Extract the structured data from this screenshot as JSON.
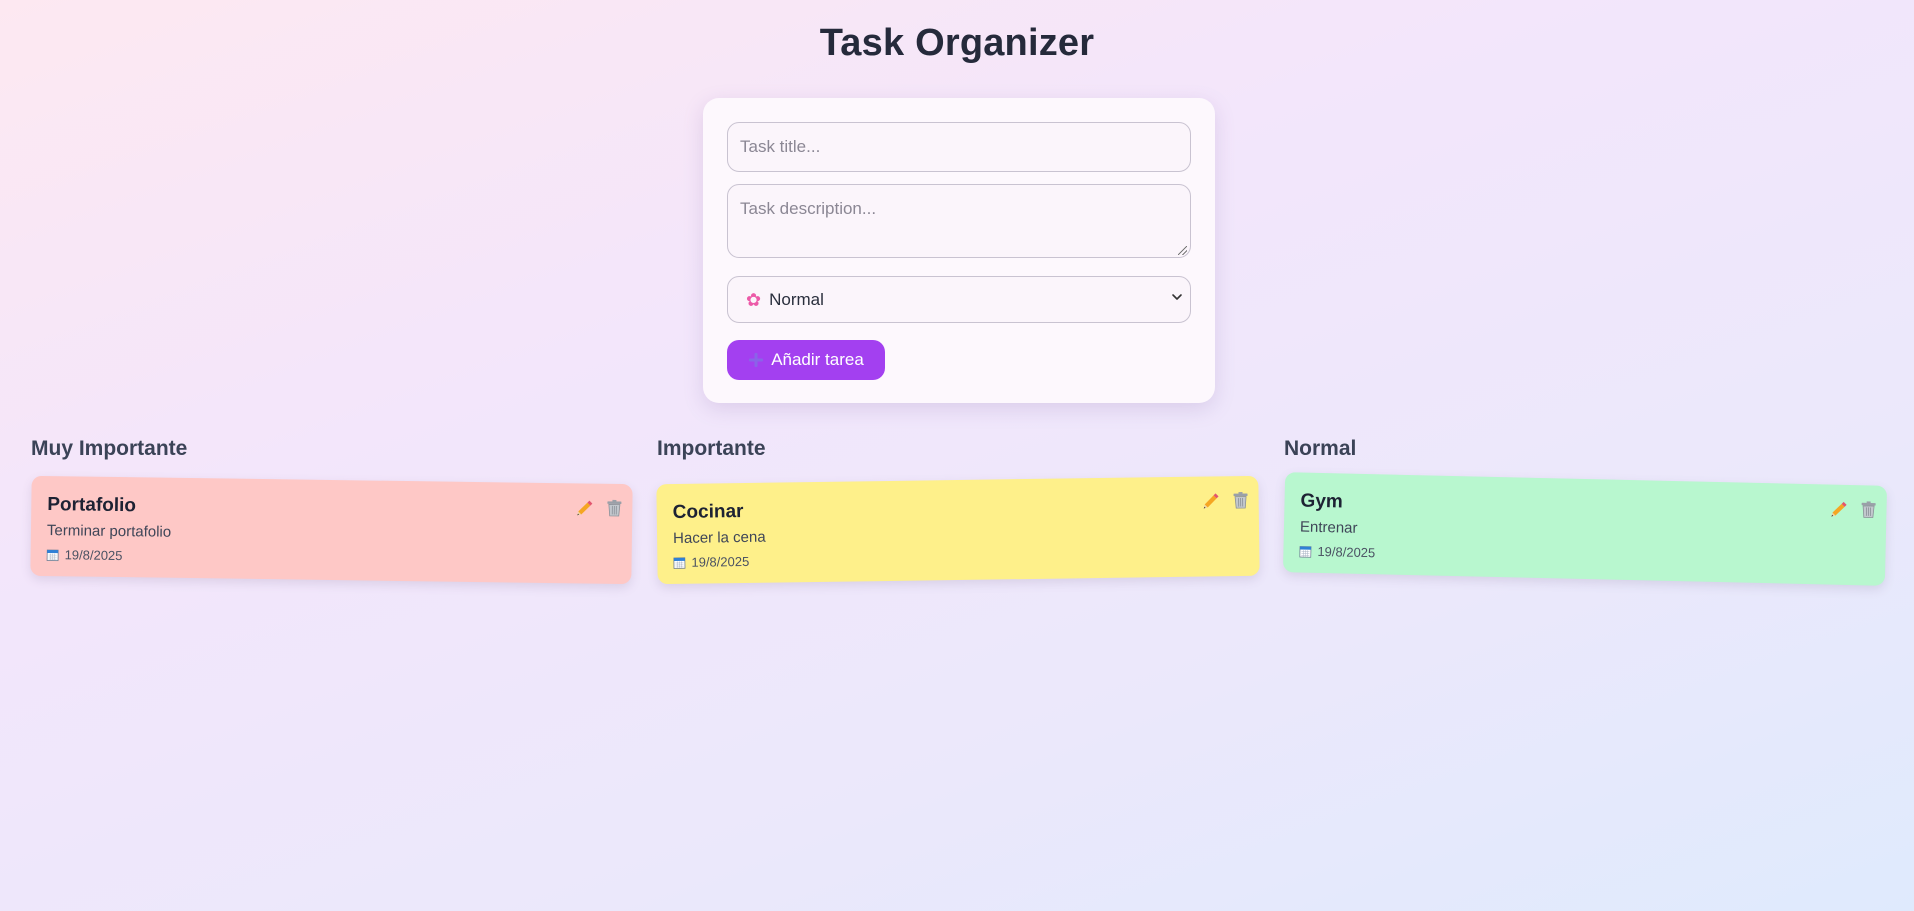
{
  "header": {
    "title": "Task Organizer"
  },
  "form": {
    "title_placeholder": "Task title...",
    "description_placeholder": "Task description...",
    "priority_icon": "flower-icon",
    "priority_icon_char": "✿",
    "priority_selected": "Normal",
    "add_label": "Añadir tarea",
    "accent_color": "#a340f0"
  },
  "columns": [
    {
      "title": "Muy Importante",
      "color": "#fec8c6",
      "tasks": [
        {
          "title": "Portafolio",
          "description": "Terminar portafolio",
          "date": "19/8/2025"
        }
      ]
    },
    {
      "title": "Importante",
      "color": "#fef08a",
      "tasks": [
        {
          "title": "Cocinar",
          "description": "Hacer la cena",
          "date": "19/8/2025"
        }
      ]
    },
    {
      "title": "Normal",
      "color": "#b8f7cf",
      "tasks": [
        {
          "title": "Gym",
          "description": "Entrenar",
          "date": "19/8/2025"
        }
      ]
    }
  ]
}
